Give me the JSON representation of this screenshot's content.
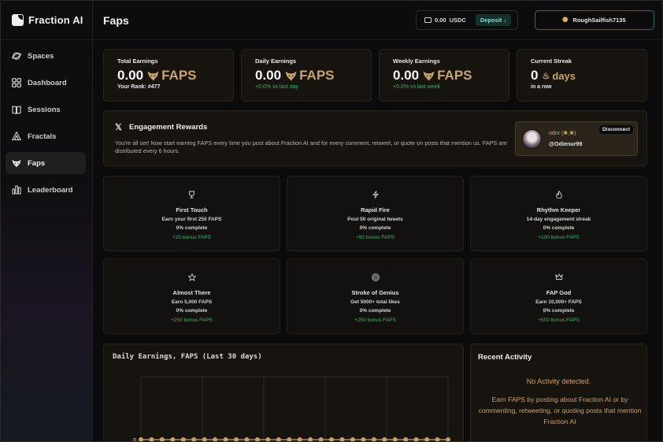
{
  "app": {
    "name": "Fraction AI"
  },
  "sidebar": {
    "items": [
      {
        "label": "Spaces",
        "icon": "planet-icon",
        "active": false
      },
      {
        "label": "Dashboard",
        "icon": "grid-icon",
        "active": false
      },
      {
        "label": "Sessions",
        "icon": "book-icon",
        "active": false
      },
      {
        "label": "Fractals",
        "icon": "fractal-icon",
        "active": false
      },
      {
        "label": "Faps",
        "icon": "fox-icon",
        "active": true
      },
      {
        "label": "Leaderboard",
        "icon": "bar-chart-icon",
        "active": false
      }
    ]
  },
  "header": {
    "title": "Faps",
    "wallet": {
      "balance": "0.00",
      "currency": "USDC",
      "deposit_label": "Deposit ↓"
    },
    "user": {
      "name": "RoughSailfish7135"
    }
  },
  "stats": [
    {
      "label": "Total Earnings",
      "value": "0.00",
      "unit": "FAPS",
      "sub": "Your Rank: #477",
      "sub_style": "white"
    },
    {
      "label": "Daily Earnings",
      "value": "0.00",
      "unit": "FAPS",
      "sub": "+0.0% vs last day",
      "sub_style": "green"
    },
    {
      "label": "Weekly Earnings",
      "value": "0.00",
      "unit": "FAPS",
      "sub": "+0.0% vs last week",
      "sub_style": "green"
    },
    {
      "label": "Current Streak",
      "value": "0",
      "unit": "days",
      "sub": "in a row",
      "sub_style": "white"
    }
  ],
  "engagement": {
    "title": "Engagement Rewards",
    "description": "You're all set! Now start earning FAPS every time you post about Fraction AI and for every comment, retweet, or quote on posts that mention us. FAPS are distributed every 6 hours.",
    "account": {
      "display_name": "odnr (✱,✱)",
      "handle": "@Odienur99",
      "disconnect_label": "Disconnect"
    }
  },
  "achievements": [
    {
      "icon": "trophy-icon",
      "glyph": "♀",
      "title": "First Touch",
      "desc": "Earn your first 250 FAPS",
      "progress": "0% complete",
      "bonus": "+25 bonus FAPS"
    },
    {
      "icon": "lightning-icon",
      "glyph": "ϟ",
      "title": "Rapid Fire",
      "desc": "Post 50 original tweets",
      "progress": "0% complete",
      "bonus": "+50 bonus FAPS"
    },
    {
      "icon": "flame-icon",
      "glyph": "♨",
      "title": "Rhythm Keeper",
      "desc": "14-day engagement streak",
      "progress": "0% complete",
      "bonus": "+100 bonus FAPS"
    },
    {
      "icon": "star-icon",
      "glyph": "☆",
      "title": "Almost There",
      "desc": "Earn 5,000 FAPS",
      "progress": "0% complete",
      "bonus": "+250 bonus FAPS"
    },
    {
      "icon": "target-icon",
      "glyph": "◎",
      "title": "Stroke of Genius",
      "desc": "Get 5000+ total likes",
      "progress": "0% complete",
      "bonus": "+250 bonus FAPS"
    },
    {
      "icon": "crown-icon",
      "glyph": "♕",
      "title": "FAP God",
      "desc": "Earn 10,000+ FAPS",
      "progress": "0% complete",
      "bonus": "+500 bonus FAPS"
    }
  ],
  "activity": {
    "title": "Recent Activity",
    "empty": "No Activity detected.",
    "hint": "Earn FAPS by posting about Fraction AI or by commenting, retweeting, or quoting posts that mention Fraction AI"
  },
  "chart_data": {
    "type": "line",
    "title": "Daily Earnings, FAPS (Last 30 days)",
    "xlabel": "",
    "ylabel": "",
    "x": [
      1,
      2,
      3,
      4,
      5,
      6,
      7,
      8,
      9,
      10,
      11,
      12,
      13,
      14,
      15,
      16,
      17,
      18,
      19,
      20,
      21,
      22,
      23,
      24,
      25,
      26,
      27,
      28,
      29,
      30
    ],
    "series": [
      {
        "values": [
          0,
          0,
          0,
          0,
          0,
          0,
          0,
          0,
          0,
          0,
          0,
          0,
          0,
          0,
          0,
          0,
          0,
          0,
          0,
          0,
          0,
          0,
          0,
          0,
          0,
          0,
          0,
          0,
          0,
          0
        ],
        "color": "#c9a46a"
      }
    ],
    "y_tick_labels": [
      "0"
    ],
    "grid": true
  },
  "colors": {
    "accent": "#c9a46a",
    "green": "#33b36a",
    "teal": "#2a6f66"
  }
}
